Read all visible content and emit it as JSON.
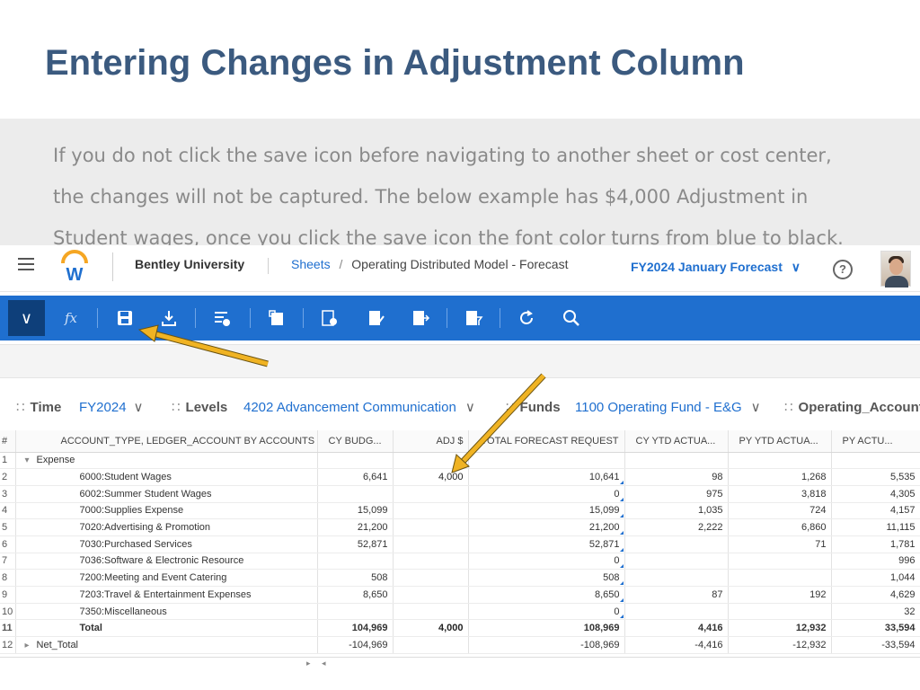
{
  "slide": {
    "title": "Entering Changes in Adjustment Column",
    "note": "If you do not click the save icon before navigating to another sheet or cost center, the changes will not be captured.  The below example has $4,000 Adjustment in Student wages, once you click the save icon the font color turns from blue to black."
  },
  "app": {
    "org": "Bentley University",
    "breadcrumb_link": "Sheets",
    "breadcrumb_sep": "/",
    "breadcrumb_current": "Operating Distributed Model - Forecast",
    "forecast_selector": "FY2024 January Forecast",
    "help_symbol": "?",
    "brand_color": "#1f6fcf"
  },
  "toolbar": {
    "icons": [
      "chevron-down-icon",
      "formula-icon",
      "save-icon",
      "download-icon",
      "add-sheet-icon",
      "template-icon",
      "settings-sheet-icon",
      "edit-sheet-icon",
      "export-sheet-icon",
      "filter-sheet-icon",
      "refresh-icon",
      "search-icon"
    ],
    "fx_label": "fx"
  },
  "filters": {
    "time_label": "Time",
    "time_value": "FY2024",
    "levels_label": "Levels",
    "levels_value": "4202 Advancement Communication",
    "funds_label": "Funds",
    "funds_value": "1100 Operating Fund - E&G",
    "account_label": "Operating_Account_"
  },
  "grid": {
    "headers": [
      "#",
      "ACCOUNT_TYPE, LEDGER_ACCOUNT BY ACCOUNTS",
      "CY BUDG...",
      "ADJ $",
      "TOTAL FORECAST REQUEST",
      "CY YTD ACTUA...",
      "PY YTD ACTUA...",
      "PY ACTU..."
    ],
    "rows": [
      {
        "n": "1",
        "account": "Expense",
        "cy_budget": "",
        "adj": "",
        "forecast": "",
        "cy_ytd": "",
        "py_ytd": "",
        "py_actual": ""
      },
      {
        "n": "2",
        "account": "6000:Student Wages",
        "cy_budget": "6,641",
        "adj": "4,000",
        "forecast": "10,641",
        "cy_ytd": "98",
        "py_ytd": "1,268",
        "py_actual": "5,535"
      },
      {
        "n": "3",
        "account": "6002:Summer Student Wages",
        "cy_budget": "",
        "adj": "",
        "forecast": "0",
        "cy_ytd": "975",
        "py_ytd": "3,818",
        "py_actual": "4,305"
      },
      {
        "n": "4",
        "account": "7000:Supplies Expense",
        "cy_budget": "15,099",
        "adj": "",
        "forecast": "15,099",
        "cy_ytd": "1,035",
        "py_ytd": "724",
        "py_actual": "4,157"
      },
      {
        "n": "5",
        "account": "7020:Advertising & Promotion",
        "cy_budget": "21,200",
        "adj": "",
        "forecast": "21,200",
        "cy_ytd": "2,222",
        "py_ytd": "6,860",
        "py_actual": "11,115"
      },
      {
        "n": "6",
        "account": "7030:Purchased Services",
        "cy_budget": "52,871",
        "adj": "",
        "forecast": "52,871",
        "cy_ytd": "",
        "py_ytd": "71",
        "py_actual": "1,781"
      },
      {
        "n": "7",
        "account": "7036:Software & Electronic Resource",
        "cy_budget": "",
        "adj": "",
        "forecast": "0",
        "cy_ytd": "",
        "py_ytd": "",
        "py_actual": "996"
      },
      {
        "n": "8",
        "account": "7200:Meeting and Event Catering",
        "cy_budget": "508",
        "adj": "",
        "forecast": "508",
        "cy_ytd": "",
        "py_ytd": "",
        "py_actual": "1,044"
      },
      {
        "n": "9",
        "account": "7203:Travel & Entertainment Expenses",
        "cy_budget": "8,650",
        "adj": "",
        "forecast": "8,650",
        "cy_ytd": "87",
        "py_ytd": "192",
        "py_actual": "4,629"
      },
      {
        "n": "10",
        "account": "7350:Miscellaneous",
        "cy_budget": "",
        "adj": "",
        "forecast": "0",
        "cy_ytd": "",
        "py_ytd": "",
        "py_actual": "32"
      },
      {
        "n": "11",
        "account": "Total",
        "cy_budget": "104,969",
        "adj": "4,000",
        "forecast": "108,969",
        "cy_ytd": "4,416",
        "py_ytd": "12,932",
        "py_actual": "33,594"
      },
      {
        "n": "12",
        "account": "Net_Total",
        "cy_budget": "-104,969",
        "adj": "",
        "forecast": "-108,969",
        "cy_ytd": "-4,416",
        "py_ytd": "-12,932",
        "py_actual": "-33,594"
      }
    ]
  },
  "arrow_color": "#f0b323"
}
